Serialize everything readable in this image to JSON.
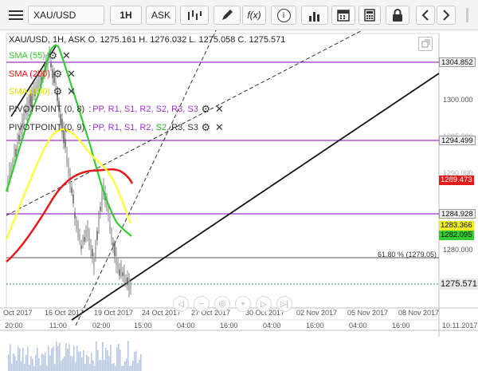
{
  "toolbar": {
    "symbol": "XAU/USD",
    "timeframe": "1H",
    "price_type": "ASK",
    "fx_label": "f(x)",
    "info_label": "i"
  },
  "ohlc_header": "XAU/USD, 1H, ASK   O. 1275.161 H. 1276.032 L. 1275.058 C. 1275.571",
  "indicators": [
    {
      "label": "SMA (55)",
      "color": "#33cc33"
    },
    {
      "label": "SMA (200)",
      "color": "#ee1111"
    },
    {
      "label": "SMA (100)",
      "color": "#dddd00"
    }
  ],
  "pivots": [
    {
      "label": "PIVOTPOINT (0, 8)",
      "items": [
        {
          "t": "PP",
          "c": "#9933cc"
        },
        {
          "t": "R1",
          "c": "#9933cc"
        },
        {
          "t": "S1",
          "c": "#9933cc"
        },
        {
          "t": "R2",
          "c": "#9933cc"
        },
        {
          "t": "S2",
          "c": "#9933cc"
        },
        {
          "t": "R3",
          "c": "#9933cc"
        },
        {
          "t": "S3",
          "c": "#9933cc"
        }
      ]
    },
    {
      "label": "PIVOTPOINT (0, 9)",
      "items": [
        {
          "t": "PP",
          "c": "#9933cc"
        },
        {
          "t": "R1",
          "c": "#9933cc"
        },
        {
          "t": "S1",
          "c": "#9933cc"
        },
        {
          "t": "R2",
          "c": "#9933cc"
        },
        {
          "t": "S2",
          "c": "#22aa22"
        },
        {
          "t": "R3",
          "c": "#333333"
        },
        {
          "t": "S3",
          "c": "#333333"
        }
      ]
    }
  ],
  "price_axis": [
    "1300.000",
    "1295.000",
    "1290.000",
    "1280.000"
  ],
  "price_tags": [
    {
      "text": "1304.852",
      "bg": "#eeeeee",
      "fg": "#111111"
    },
    {
      "text": "1294.499",
      "bg": "#eeeeee",
      "fg": "#111111"
    },
    {
      "text": "1289.473",
      "bg": "#e61a1a",
      "fg": "#ffffff"
    },
    {
      "text": "1284.928",
      "bg": "#eeeeee",
      "fg": "#111111"
    },
    {
      "text": "1283.366",
      "bg": "#eeee22",
      "fg": "#111111"
    },
    {
      "text": "1282.095",
      "bg": "#33cc33",
      "fg": "#111111"
    },
    {
      "text": "1275.571",
      "bg": "#e8e8e8",
      "fg": "#111111"
    }
  ],
  "fib_label": "61.80 % (1279.05)",
  "date_labels": [
    "Oct 2017",
    "16 Oct 2017",
    "19 Oct 2017",
    "24 Oct 2017",
    "27 Oct 2017",
    "30 Oct 2017",
    "02 Nov 2017",
    "05 Nov 2017",
    "08 Nov 2017"
  ],
  "time_labels": [
    "20:00",
    "11:00",
    "02:00",
    "15:00",
    "04:00",
    "16:00",
    "04:00",
    "16:00",
    "04:00",
    "16:00",
    "10.11.2017"
  ]
}
